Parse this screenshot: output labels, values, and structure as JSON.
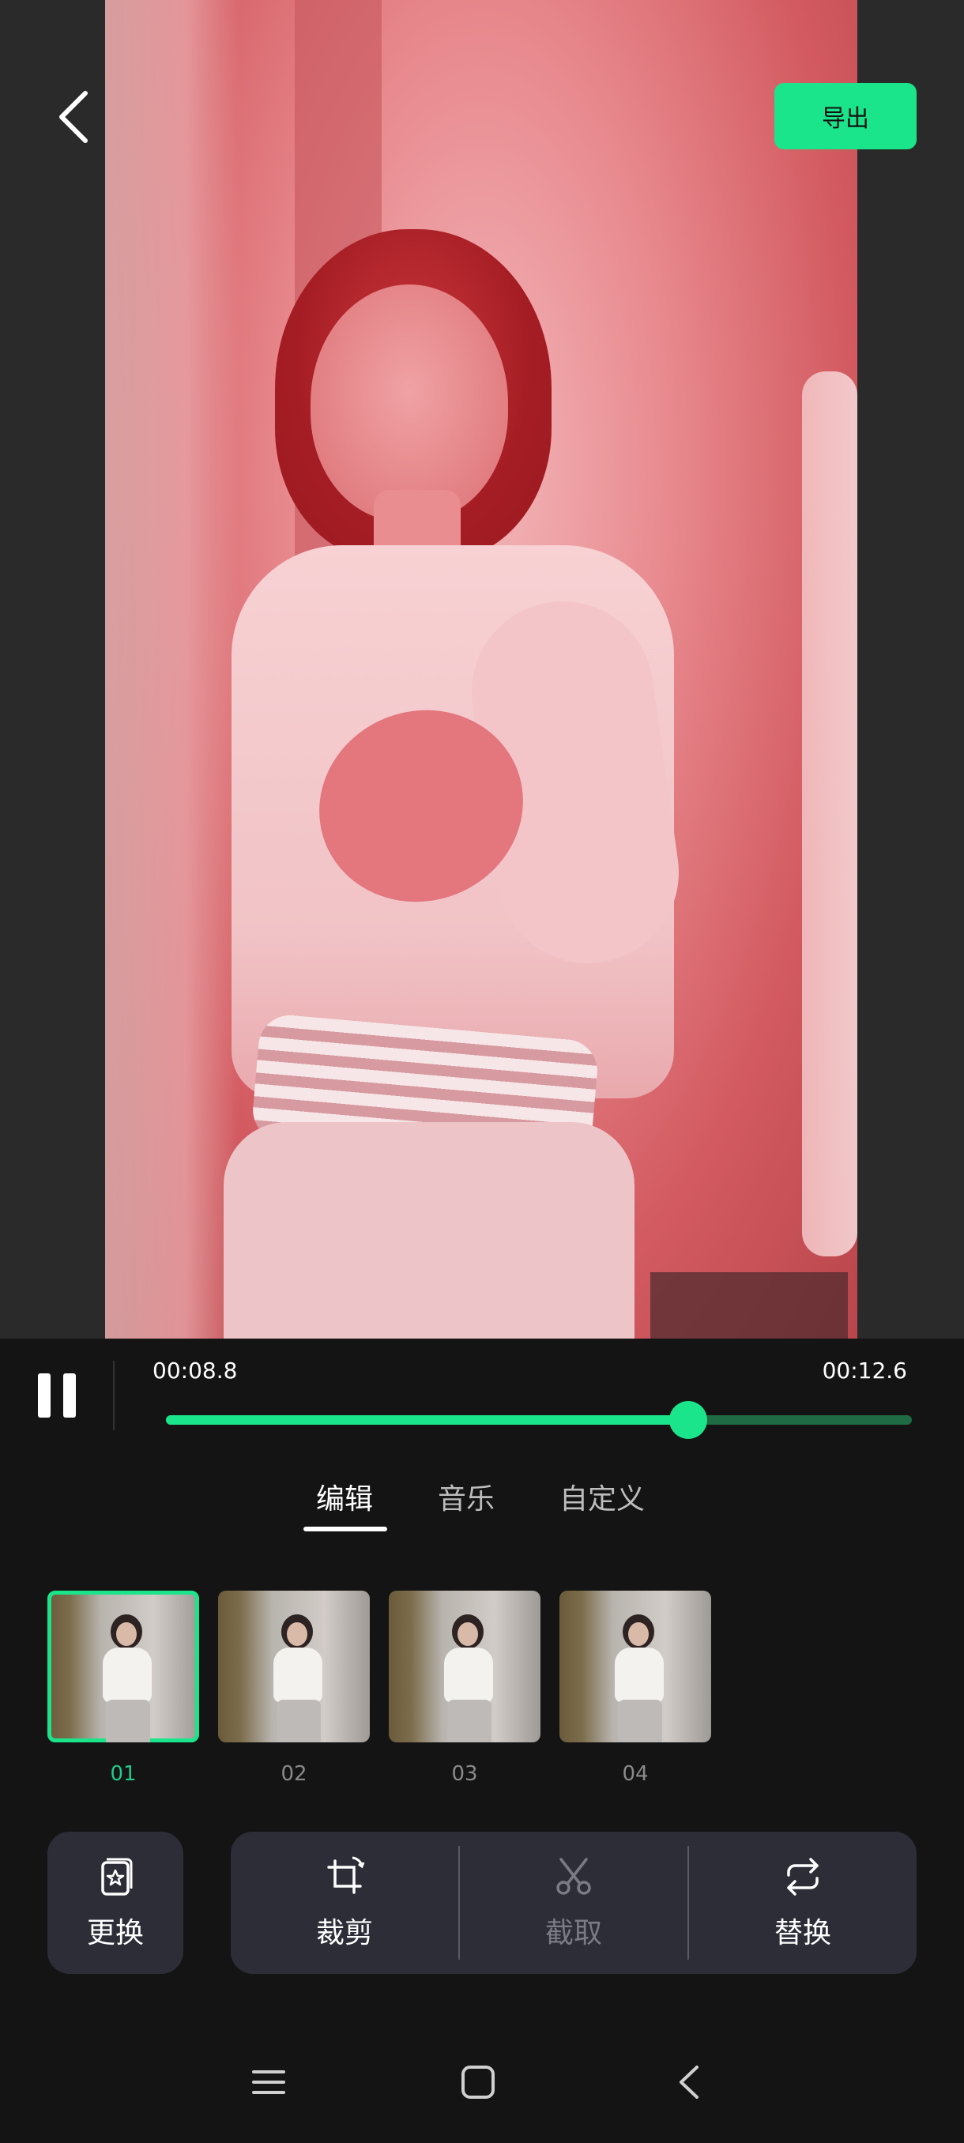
{
  "header": {
    "export_label": "导出"
  },
  "playback": {
    "current_time": "00:08.8",
    "total_time": "00:12.6",
    "progress": 0.7
  },
  "tabs": [
    {
      "label": "编辑",
      "active": true
    },
    {
      "label": "音乐",
      "active": false
    },
    {
      "label": "自定义",
      "active": false
    }
  ],
  "clips": [
    {
      "label": "01",
      "selected": true
    },
    {
      "label": "02",
      "selected": false
    },
    {
      "label": "03",
      "selected": false
    },
    {
      "label": "04",
      "selected": false
    }
  ],
  "actions": {
    "replace_template": {
      "label": "更换",
      "icon": "template-swap-icon"
    },
    "crop": {
      "label": "裁剪",
      "icon": "crop-rotate-icon"
    },
    "trim": {
      "label": "截取",
      "icon": "scissors-icon",
      "disabled": true
    },
    "replace": {
      "label": "替换",
      "icon": "swap-arrows-icon"
    }
  },
  "colors": {
    "accent": "#1ae58a",
    "panel": "#2d2d38",
    "background": "#141414"
  }
}
